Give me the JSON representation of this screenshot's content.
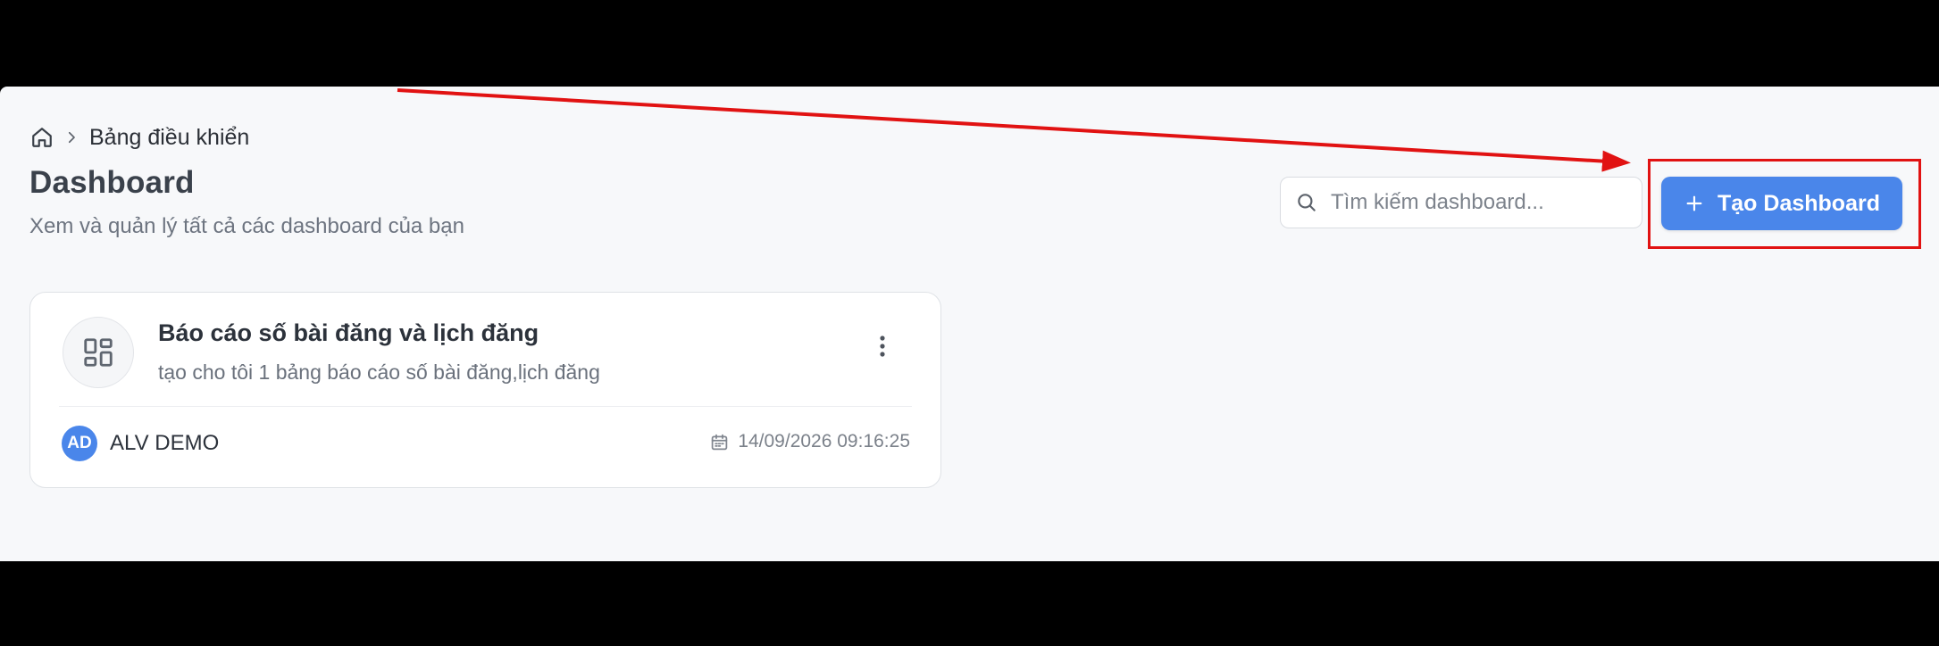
{
  "breadcrumb": {
    "home_icon": "home-icon",
    "separator_icon": "chevron-right-icon",
    "current": "Bảng điều khiển"
  },
  "page": {
    "title": "Dashboard",
    "subtitle": "Xem và quản lý tất cả các dashboard của bạn"
  },
  "search": {
    "placeholder": "Tìm kiếm dashboard...",
    "value": "",
    "icon": "search-icon"
  },
  "create_button": {
    "label": "Tạo Dashboard",
    "icon": "plus-icon",
    "color": "#4a86ea"
  },
  "annotation": {
    "color": "#e11212"
  },
  "dashboards": [
    {
      "icon": "layout-grid-icon",
      "title": "Báo cáo số bài đăng và lịch đăng",
      "description": "tạo cho tôi 1 bảng báo cáo số bài đăng,lịch đăng",
      "menu_icon": "more-vertical-icon",
      "owner_initials": "AD",
      "owner_name": "ALV DEMO",
      "date_icon": "calendar-icon",
      "created_at": "14/09/2026 09:16:25"
    }
  ]
}
